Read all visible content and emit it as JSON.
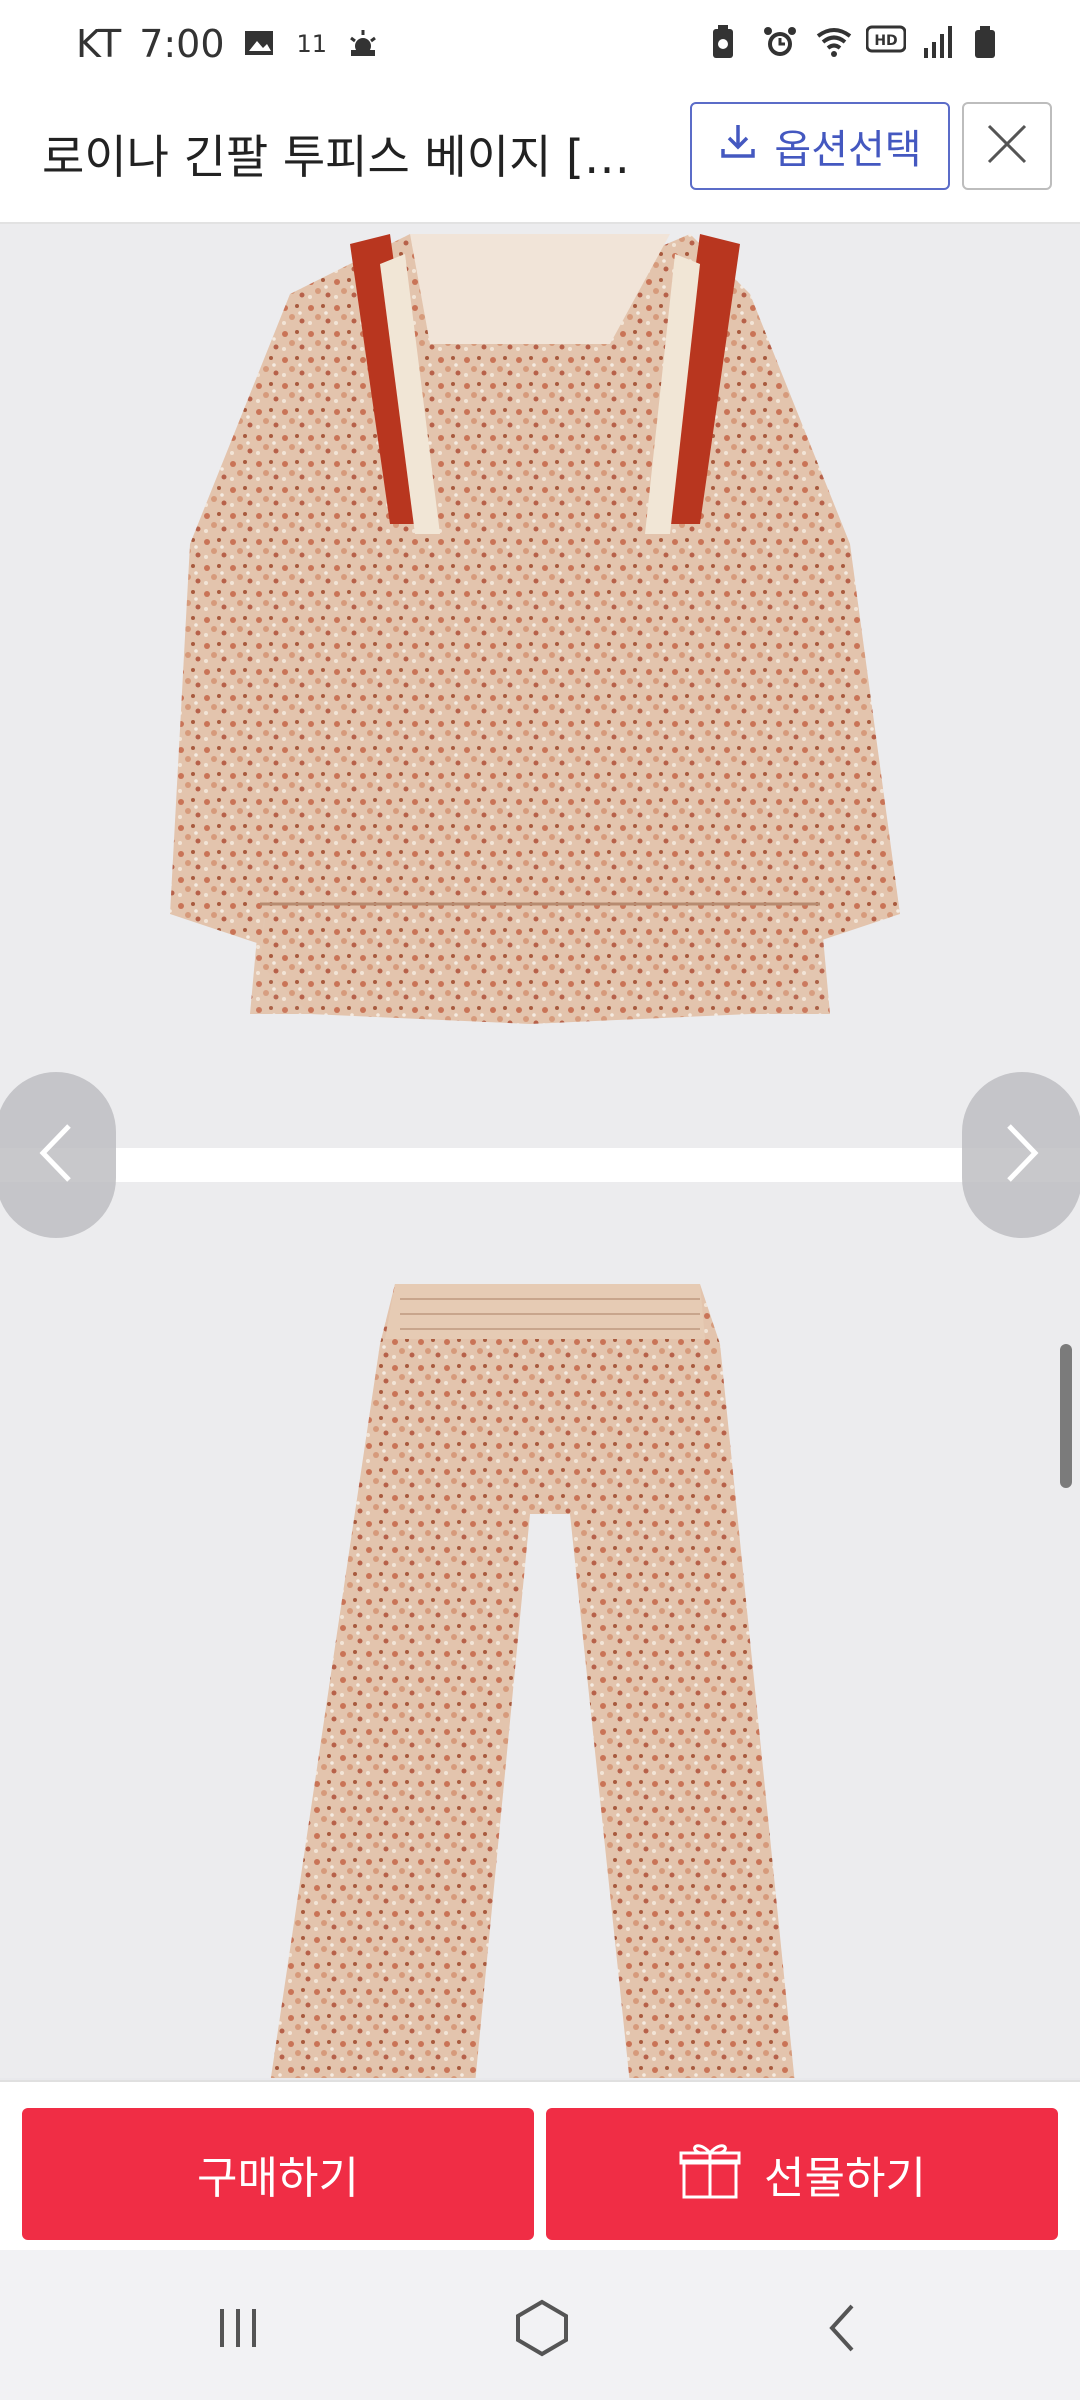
{
  "status_bar": {
    "carrier": "KT",
    "time": "7:00",
    "weather_badge": "11",
    "icons": [
      "image-icon",
      "weather-icon",
      "battery-saver-icon",
      "alarm-icon",
      "wifi-icon",
      "hd-icon",
      "signal-icon",
      "battery-icon"
    ],
    "hd_label": "HD"
  },
  "header": {
    "title": "로이나 긴팔 투피스 베이지 [WTLL...",
    "option_button": "옵션선택",
    "close_icon": "close-icon"
  },
  "gallery": {
    "top_image_alt": "blouse",
    "bottom_image_alt": "pants"
  },
  "footer": {
    "buy_label": "구매하기",
    "gift_label": "선물하기"
  },
  "colors": {
    "accent": "#f02d45",
    "option_blue": "#4458c0"
  }
}
